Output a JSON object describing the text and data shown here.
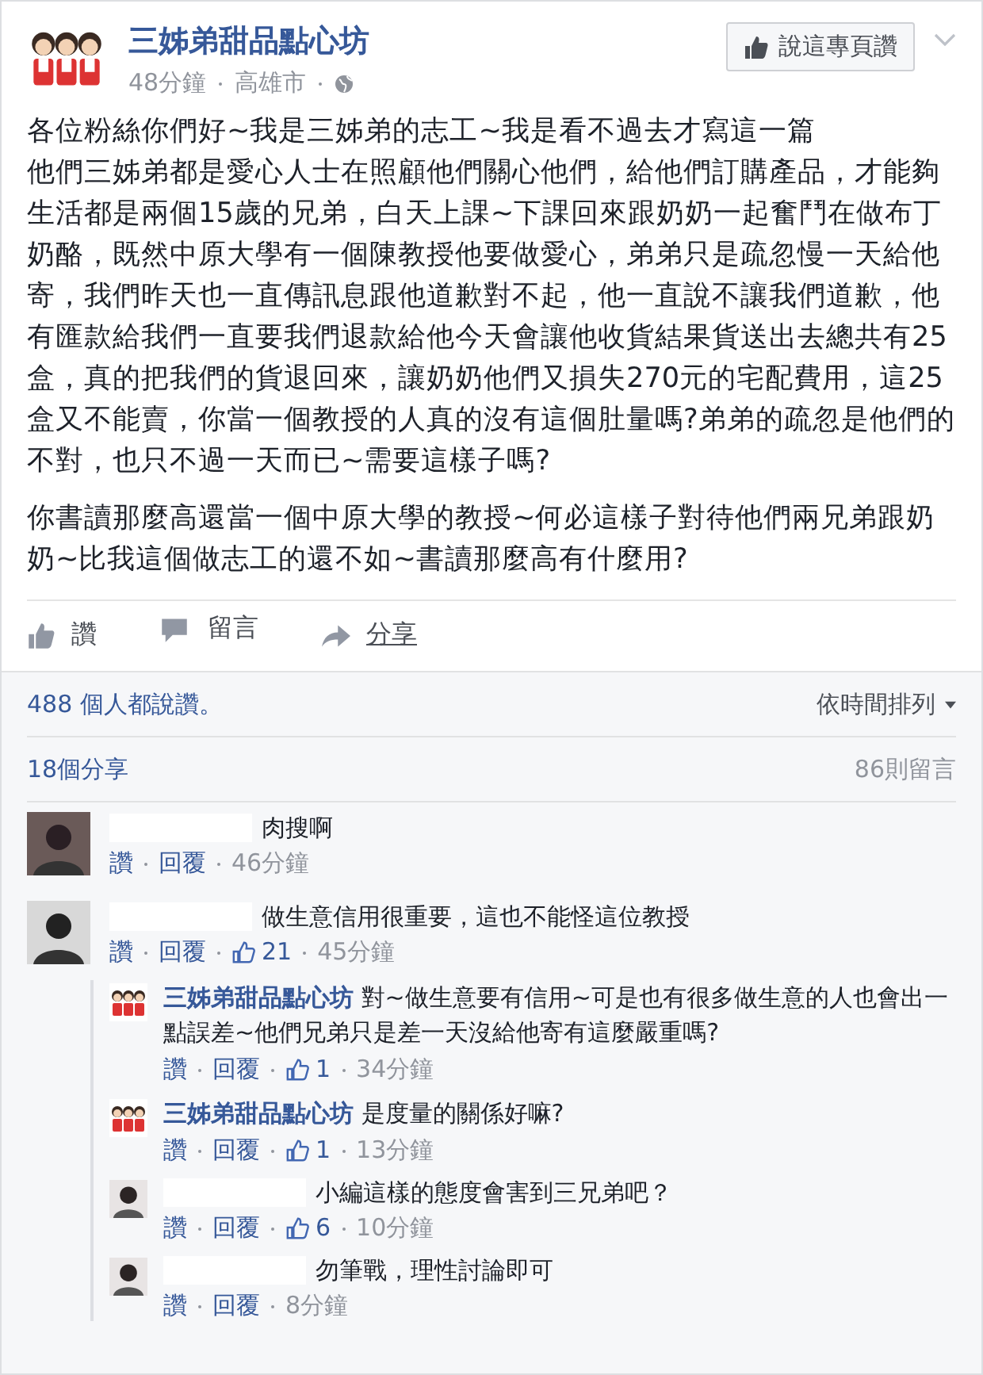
{
  "page": {
    "name": "三姊弟甜品點心坊",
    "time": "48分鐘",
    "place": "高雄市",
    "like_button": "說這專頁讚"
  },
  "post": {
    "paragraphs": [
      {
        "lines": [
          "各位粉絲你們好~我是三姊弟的志工~我是看不過去才寫這一篇",
          "他們三姊弟都是愛心人士在照顧他們關心他們，給他們訂購產品，才能夠生活都是兩個15歲的兄弟，白天上課~下課回來跟奶奶一起奮鬥在做布丁奶酪，既然中原大學有一個陳教授他要做愛心，弟弟只是疏忽慢一天給他寄，我們昨天也一直傳訊息跟他道歉對不起，他一直說不讓我們道歉，他有匯款給我們一直要我們退款給他今天會讓他收貨結果貨送出去總共有25盒，真的把我們的貨退回來，讓奶奶他們又損失270元的宅配費用，這25盒又不能賣，你當一個教授的人真的沒有這個肚量嗎?弟弟的疏忽是他們的不對，也只不過一天而已~需要這樣子嗎?"
        ]
      },
      {
        "lines": [
          "你書讀那麼高還當一個中原大學的教授~何必這樣子對待他們兩兄弟跟奶奶~比我這個做志工的還不如~書讀那麼高有什麼用?"
        ]
      }
    ]
  },
  "actions": [
    {
      "kind": "like",
      "label": "讚"
    },
    {
      "kind": "comment",
      "label": "留言"
    },
    {
      "kind": "share",
      "label": "分享"
    }
  ],
  "likes_summary": "488 個人都說讚。",
  "sort": "依時間排列",
  "shares": "18個分享",
  "comment_count": "86則留言",
  "comments": [
    {
      "kind": "user",
      "text": "肉搜啊",
      "like": "讚",
      "reply": "回覆",
      "time": "46分鐘"
    },
    {
      "kind": "user",
      "text": "做生意信用很重要，這也不能怪這位教授",
      "like": "讚",
      "reply": "回覆",
      "likes": "21",
      "time": "45分鐘",
      "replies": [
        {
          "kind": "page",
          "author": "三姊弟甜品點心坊",
          "text": "對~做生意要有信用~可是也有很多做生意的人也會出一點誤差~他們兄弟只是差一天沒給他寄有這麼嚴重嗎?",
          "like": "讚",
          "reply": "回覆",
          "likes": "1",
          "time": "34分鐘"
        },
        {
          "kind": "page",
          "author": "三姊弟甜品點心坊",
          "text": "是度量的關係好嘛?",
          "like": "讚",
          "reply": "回覆",
          "likes": "1",
          "time": "13分鐘"
        },
        {
          "kind": "user",
          "text": "小編這樣的態度會害到三兄弟吧？",
          "like": "讚",
          "reply": "回覆",
          "likes": "6",
          "time": "10分鐘"
        },
        {
          "kind": "user",
          "text": "勿筆戰，理性討論即可",
          "like": "讚",
          "reply": "回覆",
          "time": "8分鐘"
        }
      ]
    }
  ]
}
